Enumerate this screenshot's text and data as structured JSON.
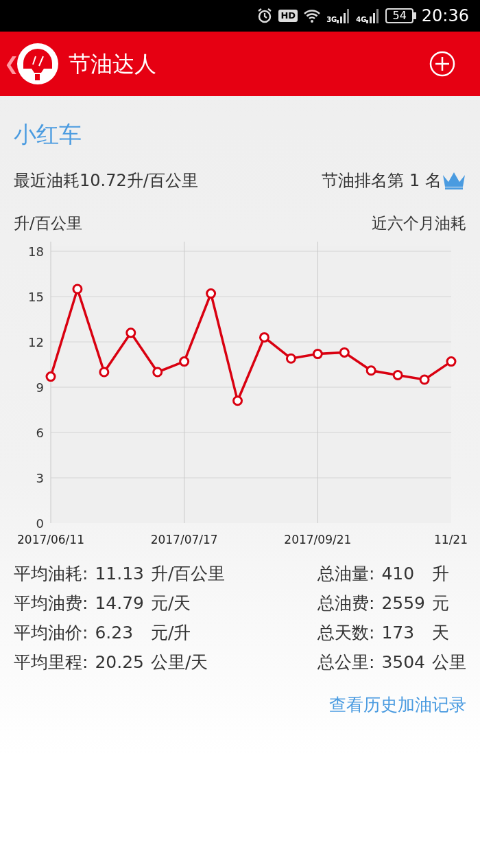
{
  "status_bar": {
    "hd": "HD",
    "net1": "3G",
    "net2": "4G",
    "battery": "54",
    "time": "20:36"
  },
  "header": {
    "back": "❮",
    "title": "节油达人"
  },
  "car": {
    "name": "小红车"
  },
  "summary": {
    "recent": "最近油耗10.72升/百公里",
    "rank": "节油排名第 1 名"
  },
  "chart": {
    "unit_label": "升/百公里",
    "period_label": "近六个月油耗",
    "chart_data": {
      "type": "line",
      "categories": [
        "2017/06/11",
        null,
        null,
        null,
        null,
        "2017/07/17",
        null,
        null,
        null,
        null,
        "2017/09/21",
        null,
        null,
        null,
        null,
        "11/21"
      ],
      "grid": true,
      "series": [
        {
          "color": "#d90010",
          "marker": true,
          "values": [
            9.7,
            15.5,
            10.0,
            12.6,
            10.0,
            10.7,
            15.2,
            8.1,
            12.3,
            10.9,
            11.2,
            11.3,
            10.1,
            9.8,
            9.5,
            10.7
          ]
        }
      ],
      "ylim": [
        0,
        18
      ],
      "yticks": [
        0,
        3,
        6,
        9,
        12,
        15,
        18
      ]
    }
  },
  "stats_left": [
    {
      "label": "平均油耗:",
      "value": "11.13",
      "unit": "升/百公里"
    },
    {
      "label": "平均油费:",
      "value": "14.79",
      "unit": "元/天"
    },
    {
      "label": "平均油价:",
      "value": "6.23",
      "unit": "元/升"
    },
    {
      "label": "平均里程:",
      "value": "20.25",
      "unit": "公里/天"
    }
  ],
  "stats_right": [
    {
      "label": "总油量:",
      "value": "410",
      "unit": "升"
    },
    {
      "label": "总油费:",
      "value": "2559",
      "unit": "元"
    },
    {
      "label": "总天数:",
      "value": "173",
      "unit": "天"
    },
    {
      "label": "总公里:",
      "value": "3504",
      "unit": "公里"
    }
  ],
  "history_link": "查看历史加油记录"
}
